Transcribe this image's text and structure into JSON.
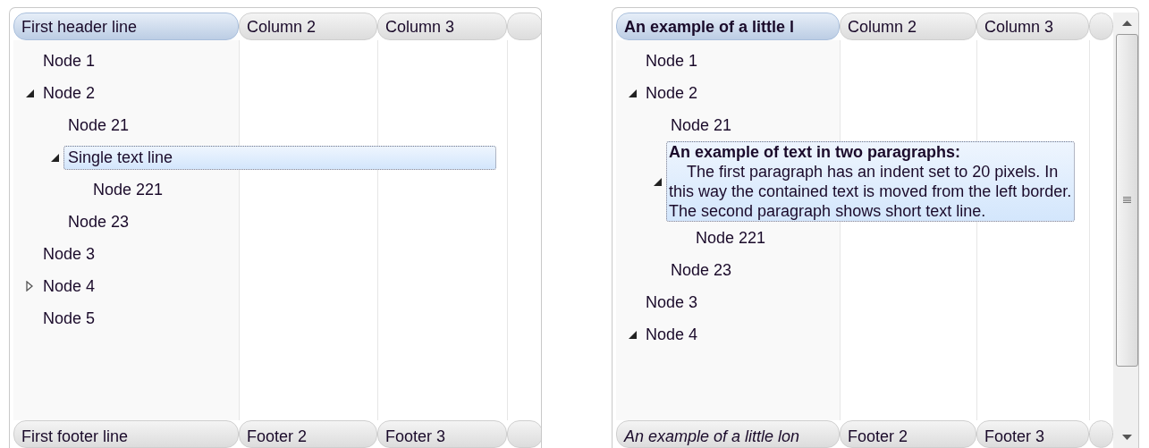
{
  "panels": [
    {
      "columns": [
        {
          "label": "First header line",
          "selected": true,
          "bold": false
        },
        {
          "label": "Column 2",
          "selected": false,
          "bold": false
        },
        {
          "label": "Column 3",
          "selected": false,
          "bold": false
        }
      ],
      "footers": [
        {
          "label": "First footer line",
          "italic": false
        },
        {
          "label": "Footer 2",
          "italic": false
        },
        {
          "label": "Footer 3",
          "italic": false
        }
      ],
      "scrollbar": false,
      "nodes": [
        {
          "kind": "line",
          "label": "Node 1",
          "selected": false
        },
        {
          "kind": "line",
          "label": "Node 2",
          "selected": false,
          "expanded": true,
          "children": [
            {
              "kind": "line",
              "label": "Node 21",
              "selected": false
            },
            {
              "kind": "line",
              "label": "Single text line",
              "selected": true,
              "expanded": true,
              "children": [
                {
                  "kind": "line",
                  "label": "Node 221",
                  "selected": false
                }
              ]
            },
            {
              "kind": "line",
              "label": "Node 23",
              "selected": false
            }
          ]
        },
        {
          "kind": "line",
          "label": "Node 3",
          "selected": false
        },
        {
          "kind": "line",
          "label": "Node 4",
          "selected": false,
          "expanded": false
        },
        {
          "kind": "line",
          "label": "Node 5",
          "selected": false
        }
      ]
    },
    {
      "columns": [
        {
          "label": "An example of a little l",
          "selected": true,
          "bold": true
        },
        {
          "label": "Column 2",
          "selected": false,
          "bold": false
        },
        {
          "label": "Column 3",
          "selected": false,
          "bold": false
        }
      ],
      "footers": [
        {
          "label": "An example of a little lon",
          "italic": true
        },
        {
          "label": "Footer 2",
          "italic": false
        },
        {
          "label": "Footer 3",
          "italic": false
        }
      ],
      "scrollbar": true,
      "nodes": [
        {
          "kind": "line",
          "label": "Node 1",
          "selected": false
        },
        {
          "kind": "line",
          "label": "Node 2",
          "selected": false,
          "expanded": true,
          "children": [
            {
              "kind": "line",
              "label": "Node 21",
              "selected": false
            },
            {
              "kind": "paragraphs",
              "title": "An example of text in two paragraphs:",
              "paragraphs": [
                "The first paragraph has an indent set to 20 pixels. In this way the contained text is moved from the left border.",
                "The second paragraph shows short text line."
              ],
              "selected": true,
              "expanded": true,
              "children": [
                {
                  "kind": "line",
                  "label": "Node 221",
                  "selected": false
                }
              ]
            },
            {
              "kind": "line",
              "label": "Node 23",
              "selected": false
            }
          ]
        },
        {
          "kind": "line",
          "label": "Node 3",
          "selected": false
        },
        {
          "kind": "line",
          "label": "Node 4",
          "selected": false,
          "expanded": true
        }
      ]
    }
  ]
}
